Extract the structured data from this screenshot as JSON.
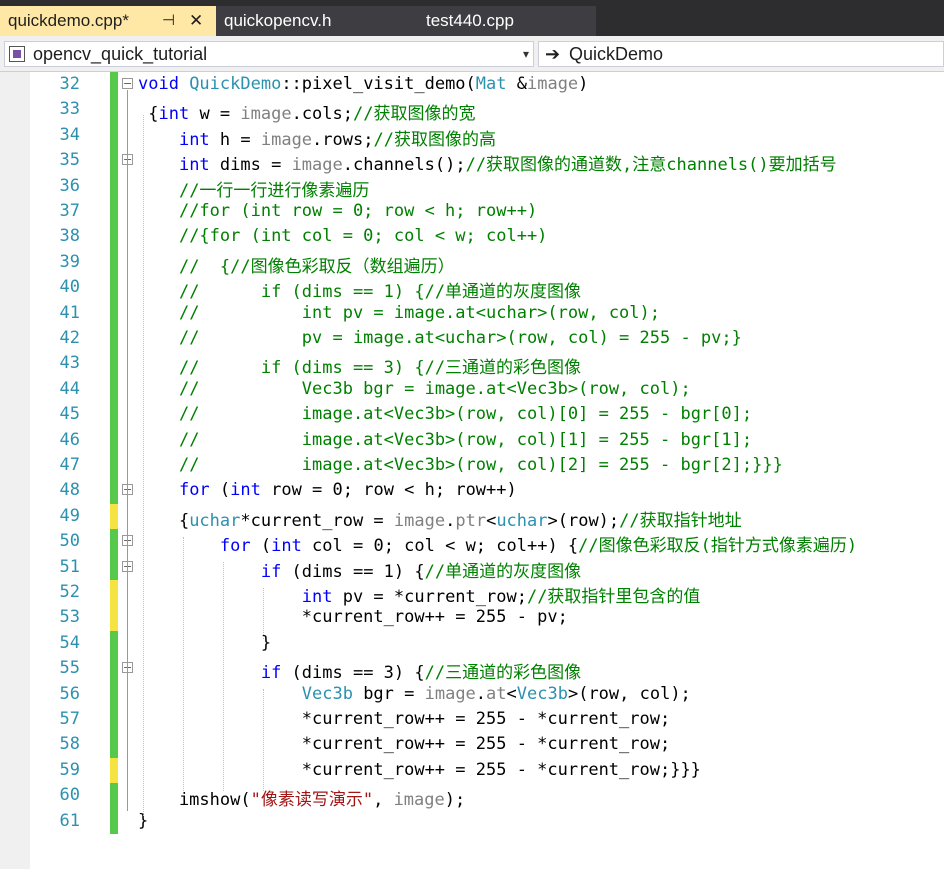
{
  "tabs": [
    {
      "label": "quickdemo.cpp*",
      "pin": "⊣",
      "close": "✕"
    },
    {
      "label": "quickopencv.h"
    },
    {
      "label": "test440.cpp"
    }
  ],
  "nav": {
    "project": "opencv_quick_tutorial",
    "member": "QuickDemo",
    "dropdown_icon": "▾",
    "arrow_icon": "➔"
  },
  "colors": {
    "keyword": "#0000ff",
    "type": "#2b91af",
    "comment": "#008000",
    "string": "#a31515",
    "saved_change": "#57c94a",
    "unsaved_change": "#f5e342"
  },
  "lines": [
    {
      "n": "32",
      "c": "g",
      "fold": "−",
      "segs": [
        [
          "kw",
          "void "
        ],
        [
          "ty",
          "QuickDemo"
        ],
        [
          "cn",
          "::pixel_visit_demo("
        ],
        [
          "ty",
          "Mat "
        ],
        [
          "cn",
          "&"
        ],
        [
          "id",
          "image"
        ],
        [
          "cn",
          ")"
        ]
      ]
    },
    {
      "n": "33",
      "c": "g",
      "segs": [
        [
          "cn",
          " {"
        ],
        [
          "kw",
          "int"
        ],
        [
          "cn",
          " w = "
        ],
        [
          "id",
          "image"
        ],
        [
          "cn",
          ".cols;"
        ],
        [
          "cm",
          "//获取图像的宽"
        ]
      ]
    },
    {
      "n": "34",
      "c": "g",
      "segs": [
        [
          "cn",
          "    "
        ],
        [
          "kw",
          "int"
        ],
        [
          "cn",
          " h = "
        ],
        [
          "id",
          "image"
        ],
        [
          "cn",
          ".rows;"
        ],
        [
          "cm",
          "//获取图像的高"
        ]
      ]
    },
    {
      "n": "35",
      "c": "g",
      "fold": "−",
      "segs": [
        [
          "cn",
          "    "
        ],
        [
          "kw",
          "int"
        ],
        [
          "cn",
          " dims = "
        ],
        [
          "id",
          "image"
        ],
        [
          "cn",
          ".channels();"
        ],
        [
          "cm",
          "//获取图像的通道数,注意channels()要加括号"
        ]
      ]
    },
    {
      "n": "36",
      "c": "g",
      "segs": [
        [
          "cn",
          "    "
        ],
        [
          "cm",
          "//一行一行进行像素遍历"
        ]
      ]
    },
    {
      "n": "37",
      "c": "g",
      "segs": [
        [
          "cn",
          "    "
        ],
        [
          "cm",
          "//for (int row = 0; row < h; row++)"
        ]
      ]
    },
    {
      "n": "38",
      "c": "g",
      "segs": [
        [
          "cn",
          "    "
        ],
        [
          "cm",
          "//{for (int col = 0; col < w; col++)"
        ]
      ]
    },
    {
      "n": "39",
      "c": "g",
      "segs": [
        [
          "cn",
          "    "
        ],
        [
          "cm",
          "//  {//图像色彩取反（数组遍历）"
        ]
      ]
    },
    {
      "n": "40",
      "c": "g",
      "segs": [
        [
          "cn",
          "    "
        ],
        [
          "cm",
          "//      if (dims == 1) {//单通道的灰度图像"
        ]
      ]
    },
    {
      "n": "41",
      "c": "g",
      "segs": [
        [
          "cn",
          "    "
        ],
        [
          "cm",
          "//          int pv = image.at<uchar>(row, col);"
        ]
      ]
    },
    {
      "n": "42",
      "c": "g",
      "segs": [
        [
          "cn",
          "    "
        ],
        [
          "cm",
          "//          pv = image.at<uchar>(row, col) = 255 - pv;}"
        ]
      ]
    },
    {
      "n": "43",
      "c": "g",
      "segs": [
        [
          "cn",
          "    "
        ],
        [
          "cm",
          "//      if (dims == 3) {//三通道的彩色图像"
        ]
      ]
    },
    {
      "n": "44",
      "c": "g",
      "segs": [
        [
          "cn",
          "    "
        ],
        [
          "cm",
          "//          Vec3b bgr = image.at<Vec3b>(row, col);"
        ]
      ]
    },
    {
      "n": "45",
      "c": "g",
      "segs": [
        [
          "cn",
          "    "
        ],
        [
          "cm",
          "//          image.at<Vec3b>(row, col)[0] = 255 - bgr[0];"
        ]
      ]
    },
    {
      "n": "46",
      "c": "g",
      "segs": [
        [
          "cn",
          "    "
        ],
        [
          "cm",
          "//          image.at<Vec3b>(row, col)[1] = 255 - bgr[1];"
        ]
      ]
    },
    {
      "n": "47",
      "c": "g",
      "segs": [
        [
          "cn",
          "    "
        ],
        [
          "cm",
          "//          image.at<Vec3b>(row, col)[2] = 255 - bgr[2];}}}"
        ]
      ]
    },
    {
      "n": "48",
      "c": "g",
      "fold": "−",
      "segs": [
        [
          "cn",
          "    "
        ],
        [
          "kw",
          "for"
        ],
        [
          "cn",
          " ("
        ],
        [
          "kw",
          "int"
        ],
        [
          "cn",
          " row = 0; row < h; row++)"
        ]
      ]
    },
    {
      "n": "49",
      "c": "y",
      "segs": [
        [
          "cn",
          "    {"
        ],
        [
          "ty",
          "uchar"
        ],
        [
          "cn",
          "*current_row = "
        ],
        [
          "id",
          "image"
        ],
        [
          "cn",
          "."
        ],
        [
          "id",
          "ptr"
        ],
        [
          "cn",
          "<"
        ],
        [
          "ty",
          "uchar"
        ],
        [
          "cn",
          ">(row);"
        ],
        [
          "cm",
          "//获取指针地址"
        ]
      ]
    },
    {
      "n": "50",
      "c": "g",
      "fold": "−",
      "segs": [
        [
          "cn",
          "        "
        ],
        [
          "kw",
          "for"
        ],
        [
          "cn",
          " ("
        ],
        [
          "kw",
          "int"
        ],
        [
          "cn",
          " col = 0; col < w; col++) {"
        ],
        [
          "cm",
          "//图像色彩取反(指针方式像素遍历)"
        ]
      ]
    },
    {
      "n": "51",
      "c": "g",
      "fold": "−",
      "segs": [
        [
          "cn",
          "            "
        ],
        [
          "kw",
          "if"
        ],
        [
          "cn",
          " (dims == 1) {"
        ],
        [
          "cm",
          "//单通道的灰度图像"
        ]
      ]
    },
    {
      "n": "52",
      "c": "y",
      "segs": [
        [
          "cn",
          "                "
        ],
        [
          "kw",
          "int"
        ],
        [
          "cn",
          " pv = *current_row;"
        ],
        [
          "cm",
          "//获取指针里包含的值"
        ]
      ]
    },
    {
      "n": "53",
      "c": "y",
      "segs": [
        [
          "cn",
          "                *current_row++ = 255 - pv;"
        ]
      ]
    },
    {
      "n": "54",
      "c": "g",
      "segs": [
        [
          "cn",
          "            }"
        ]
      ]
    },
    {
      "n": "55",
      "c": "g",
      "fold": "−",
      "segs": [
        [
          "cn",
          "            "
        ],
        [
          "kw",
          "if"
        ],
        [
          "cn",
          " (dims == 3) {"
        ],
        [
          "cm",
          "//三通道的彩色图像"
        ]
      ]
    },
    {
      "n": "56",
      "c": "g",
      "segs": [
        [
          "cn",
          "                "
        ],
        [
          "ty",
          "Vec3b"
        ],
        [
          "cn",
          " bgr = "
        ],
        [
          "id",
          "image"
        ],
        [
          "cn",
          "."
        ],
        [
          "id",
          "at"
        ],
        [
          "cn",
          "<"
        ],
        [
          "ty",
          "Vec3b"
        ],
        [
          "cn",
          ">(row, col);"
        ]
      ]
    },
    {
      "n": "57",
      "c": "g",
      "segs": [
        [
          "cn",
          "                *current_row++ = 255 - *current_row;"
        ]
      ]
    },
    {
      "n": "58",
      "c": "g",
      "segs": [
        [
          "cn",
          "                *current_row++ = 255 - *current_row;"
        ]
      ]
    },
    {
      "n": "59",
      "c": "y",
      "segs": [
        [
          "cn",
          "                *current_row++ = 255 - *current_row;}}}"
        ]
      ]
    },
    {
      "n": "60",
      "c": "g",
      "segs": [
        [
          "cn",
          "    imshow("
        ],
        [
          "st",
          "\"像素读写演示\""
        ],
        [
          "cn",
          ", "
        ],
        [
          "id",
          "image"
        ],
        [
          "cn",
          ");"
        ]
      ]
    },
    {
      "n": "61",
      "c": "g",
      "segs": [
        [
          "cn",
          "}"
        ]
      ]
    }
  ]
}
